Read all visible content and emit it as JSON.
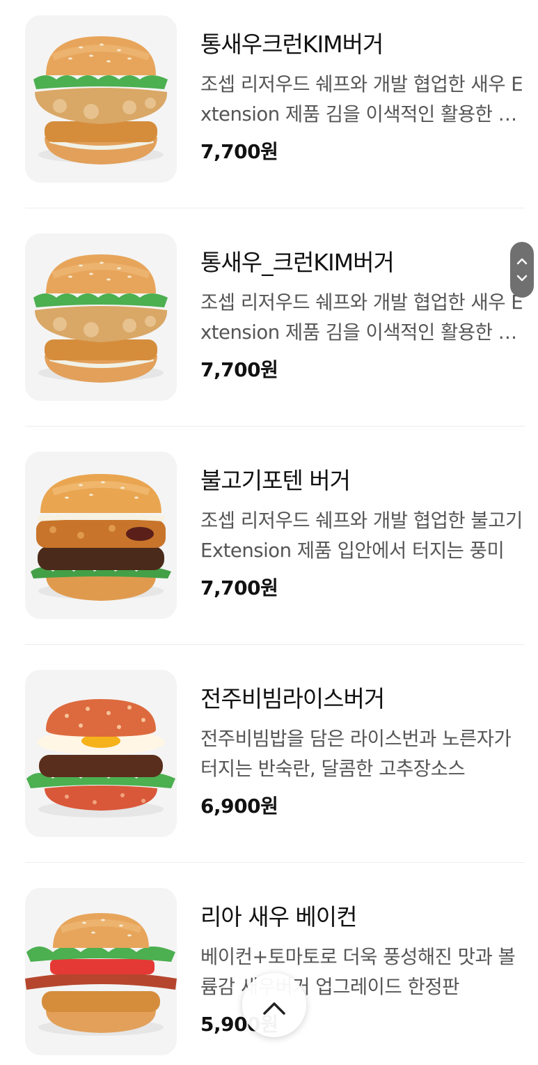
{
  "menu_items": [
    {
      "name": "통새우크런KIM버거",
      "description": "조셉 리저우드 쉐프와 개발 협업한 새우 Extension 제품 김을 이색적인 활용한 버거",
      "price": "7,700원",
      "image": "shrimp-burger"
    },
    {
      "name": "통새우_크런KIM버거",
      "description": "조셉 리저우드 쉐프와 개발 협업한 새우 Extension 제품 김을 이색적인 활용한 버거",
      "price": "7,700원",
      "image": "shrimp-burger"
    },
    {
      "name": "불고기포텐 버거",
      "description": "조셉 리저우드 쉐프와 개발 협업한 불고기 Extension 제품 입안에서 터지는 풍미",
      "price": "7,700원",
      "image": "bulgogi-burger"
    },
    {
      "name": "전주비빔라이스버거",
      "description": "전주비빔밥을 담은 라이스번과 노른자가 터지는 반숙란, 달콤한 고추장소스",
      "price": "6,900원",
      "image": "rice-burger"
    },
    {
      "name": "리아 새우 베이컨",
      "description": "베이컨+토마토로 더욱 풍성해진 맛과 볼륨감 새우버거 업그레이드 한정판",
      "price": "5,900원",
      "image": "shrimp-bacon-burger"
    }
  ],
  "scroll_handle": {
    "icons": [
      "chevron-up-icon",
      "chevron-down-icon"
    ]
  },
  "scroll_top_button": {
    "icon": "chevron-up-icon"
  },
  "colors": {
    "background": "#ffffff",
    "text_primary": "#111111",
    "text_secondary": "#555555",
    "divider": "#ececec",
    "thumbnail_background": "#f4f4f4"
  }
}
